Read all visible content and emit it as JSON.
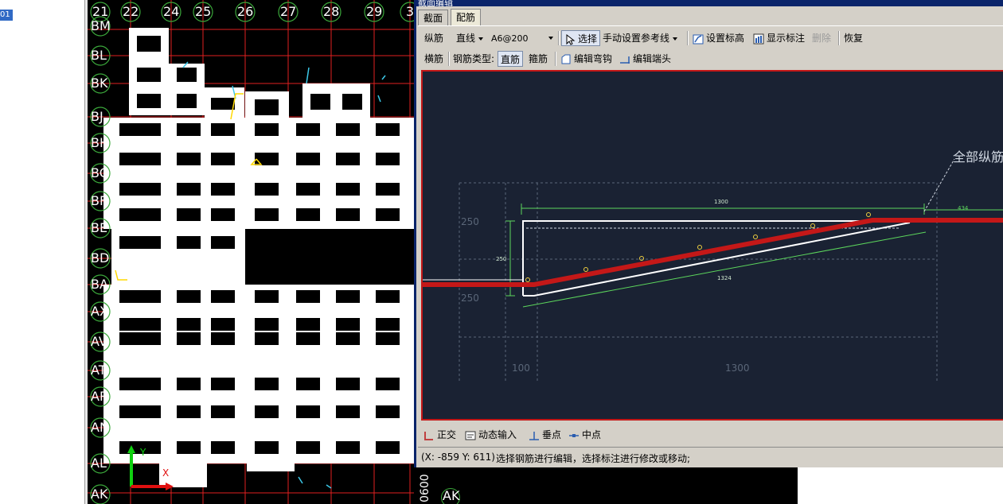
{
  "left_badge": "01",
  "cad": {
    "column_labels": [
      "21",
      "22",
      "24",
      "25",
      "26",
      "27",
      "28",
      "29",
      "3"
    ],
    "row_labels": [
      "BM",
      "BL",
      "BK",
      "BJ",
      "BH",
      "BG",
      "BF",
      "BE",
      "BD",
      "BA",
      "AX",
      "AV",
      "AT",
      "AR",
      "AN",
      "AL",
      "AK"
    ],
    "bottom_labels": {
      "vertical_dim": "0600",
      "right_axis": "AK"
    },
    "axis_y": "Y",
    "axis_x": "X"
  },
  "dialog": {
    "title": "截面编辑",
    "tabs": [
      {
        "label": "截面"
      },
      {
        "label": "配筋"
      }
    ],
    "active_tab": 1,
    "toolbar1": {
      "longitudinal_label": "纵筋",
      "line_type_value": "直线",
      "spec_value": "A6@200",
      "select_label": "选择",
      "ref_line_label": "手动设置参考线",
      "set_elevation_label": "设置标高",
      "show_dims_label": "显示标注",
      "delete_label": "删除",
      "restore_label": "恢复"
    },
    "toolbar2": {
      "transverse_label": "横筋",
      "bar_type_label": "钢筋类型:",
      "straight_label": "直筋",
      "stirrup_label": "箍筋",
      "edit_hook_label": "编辑弯钩",
      "edit_end_label": "编辑端头"
    },
    "drawing": {
      "callout": "全部纵筋",
      "dim_top": "1300",
      "dim_top_right": "434",
      "dim_left": "250",
      "dim_slope": "1324",
      "dim_height_top": "250",
      "dim_height_bottom": "250",
      "dim_bottom_left": "100",
      "dim_bottom_main": "1300"
    },
    "snap_toolbar": {
      "ortho_label": "正交",
      "dynamic_input_label": "动态输入",
      "perpendicular_label": "垂点",
      "midpoint_label": "中点"
    },
    "status": {
      "coords": "(X: -859 Y: 611)",
      "message": "选择钢筋进行编辑，选择标注进行修改或移动;"
    }
  }
}
